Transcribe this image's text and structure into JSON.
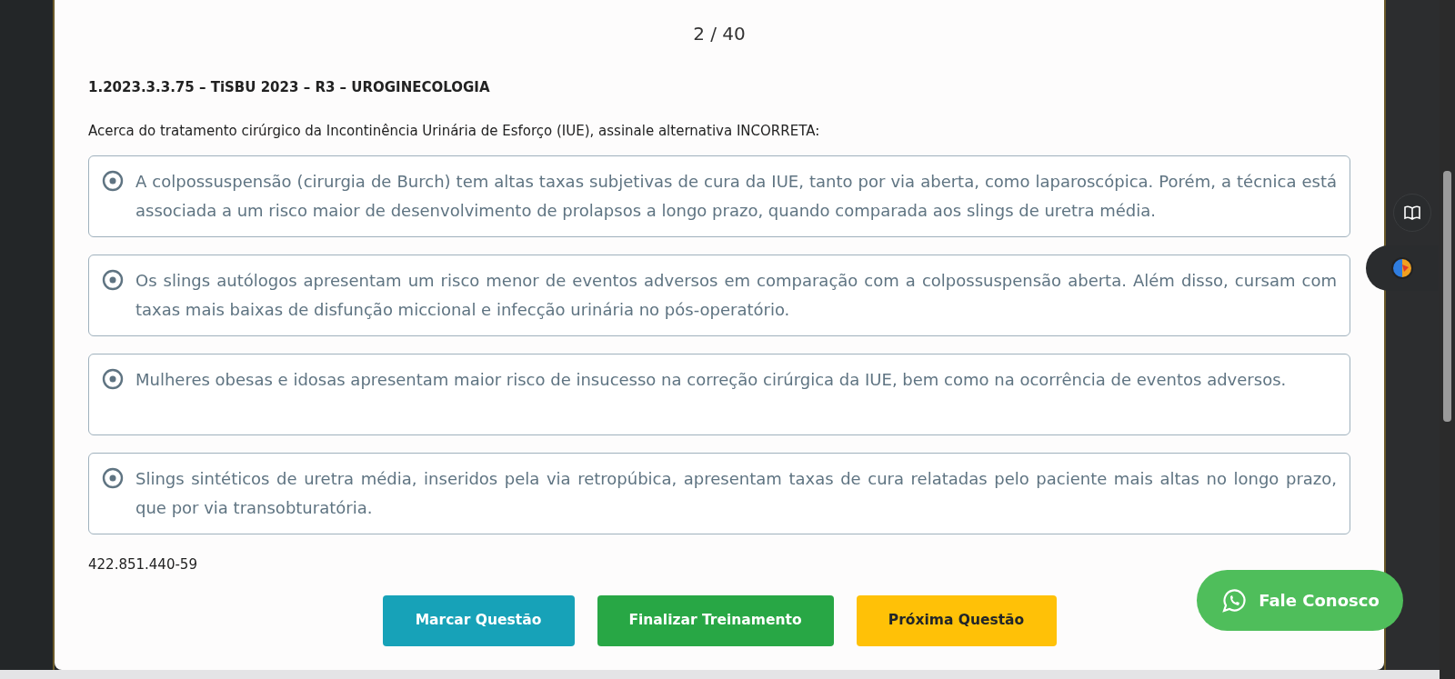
{
  "pagination": "2 / 40",
  "question": {
    "code": "1.2023.3.3.75 – TiSBU 2023 – R3 – UROGINECOLOGIA",
    "prompt": "Acerca do tratamento cirúrgico da Incontinência Urinária de Esforço (IUE), assinale alternativa INCORRETA:"
  },
  "options": [
    {
      "text": "A colpossuspensão (cirurgia de Burch) tem altas taxas subjetivas de cura da IUE, tanto por via aberta, como laparoscópica. Porém, a técnica está associada a um risco maior de desenvolvimento de prolapsos a longo prazo, quando comparada aos slings de uretra média.",
      "selected": false
    },
    {
      "text": "Os slings autólogos apresentam um risco menor de eventos adversos em comparação com a colpossuspensão aberta. Além disso, cursam com taxas mais baixas de disfunção miccional e infecção urinária no pós-operatório.",
      "selected": false
    },
    {
      "text": "Mulheres obesas e idosas apresentam maior risco de insucesso na correção cirúrgica da IUE, bem como na ocorrência de eventos adversos.",
      "selected": false
    },
    {
      "text": "Slings sintéticos de uretra média, inseridos pela via retropúbica, apresentam taxas de cura relatadas pelo paciente mais altas no longo prazo, que por via transobturatória.",
      "selected": false
    }
  ],
  "user_id": "422.851.440-59",
  "buttons": [
    {
      "label": "Marcar Questão",
      "kind": "mark"
    },
    {
      "label": "Finalizar Treinamento",
      "kind": "finish"
    },
    {
      "label": "Próxima Questão",
      "kind": "next"
    }
  ],
  "contact_button": "Fale Conosco"
}
